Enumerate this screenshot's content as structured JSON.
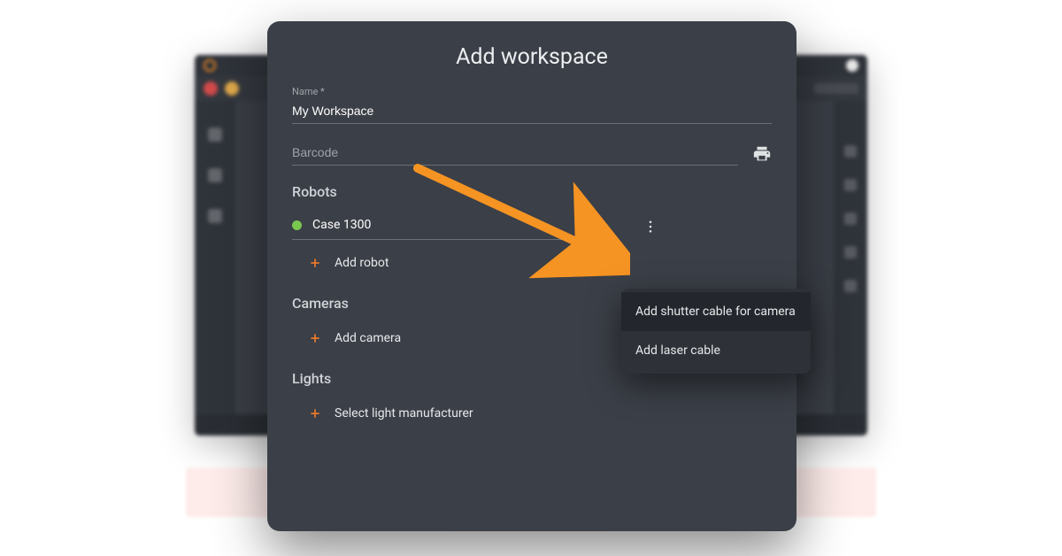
{
  "dialog": {
    "title": "Add workspace",
    "name_label": "Name *",
    "name_value": "My Workspace",
    "barcode_placeholder": "Barcode",
    "barcode_value": ""
  },
  "robots": {
    "heading": "Robots",
    "item_name": "Case 1300",
    "add_label": "Add robot"
  },
  "cameras": {
    "heading": "Cameras",
    "add_label": "Add camera"
  },
  "lights": {
    "heading": "Lights",
    "add_label": "Select light manufacturer"
  },
  "menu": {
    "item1": "Add shutter cable for camera",
    "item2": "Add laser cable"
  }
}
